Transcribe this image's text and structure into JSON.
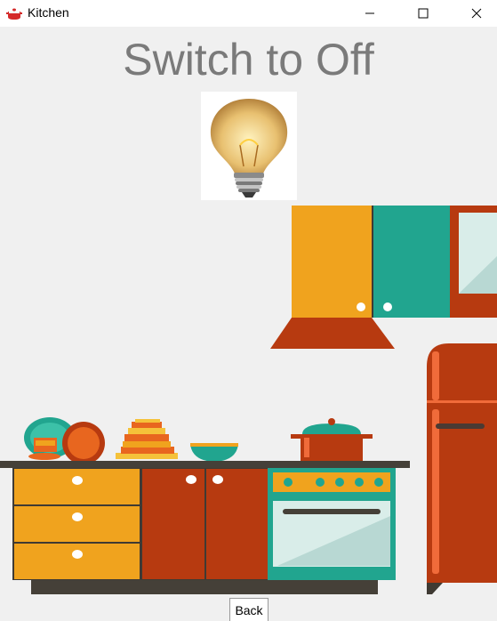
{
  "window": {
    "title": "Kitchen"
  },
  "main": {
    "heading": "Switch to Off",
    "back_label": "Back"
  },
  "colors": {
    "heading": "#7a7a7a",
    "background": "#f0f0f0",
    "cabinet_yellow": "#f0a31e",
    "cabinet_teal": "#21a58f",
    "cabinet_rust": "#b73a10",
    "counter_dark": "#454038"
  },
  "icons": [
    "kitchen-pot-icon",
    "minimize-icon",
    "maximize-icon",
    "close-icon",
    "light-bulb-icon"
  ]
}
